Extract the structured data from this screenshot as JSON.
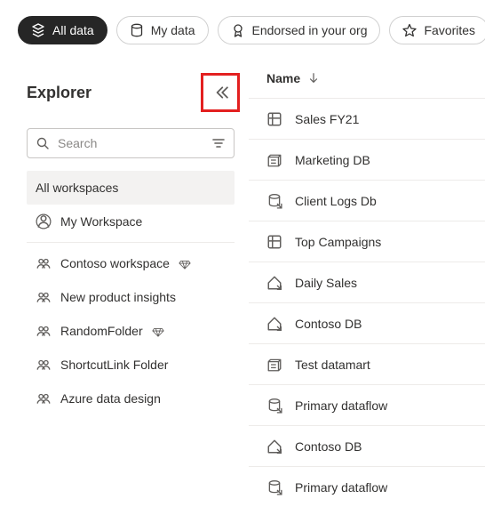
{
  "filters": {
    "all_data": "All data",
    "my_data": "My data",
    "endorsed": "Endorsed in your org",
    "favorites": "Favorites"
  },
  "explorer": {
    "title": "Explorer",
    "search_placeholder": "Search",
    "all_workspaces": "All workspaces",
    "items": [
      {
        "label": "My Workspace",
        "icon": "person",
        "premium": false
      },
      {
        "label": "Contoso workspace",
        "icon": "group",
        "premium": true
      },
      {
        "label": "New product insights",
        "icon": "group",
        "premium": false
      },
      {
        "label": "RandomFolder",
        "icon": "group",
        "premium": true
      },
      {
        "label": "ShortcutLink Folder",
        "icon": "group",
        "premium": false
      },
      {
        "label": "Azure data design",
        "icon": "group",
        "premium": false
      }
    ]
  },
  "table": {
    "name_header": "Name",
    "rows": [
      {
        "label": "Sales FY21",
        "icon": "dataset"
      },
      {
        "label": "Marketing DB",
        "icon": "datamart"
      },
      {
        "label": "Client Logs Db",
        "icon": "dataflow"
      },
      {
        "label": "Top Campaigns",
        "icon": "dataset"
      },
      {
        "label": "Daily Sales",
        "icon": "house"
      },
      {
        "label": "Contoso DB",
        "icon": "house"
      },
      {
        "label": "Test datamart",
        "icon": "datamart"
      },
      {
        "label": "Primary dataflow",
        "icon": "dataflow"
      },
      {
        "label": "Contoso DB",
        "icon": "house"
      },
      {
        "label": "Primary dataflow",
        "icon": "dataflow"
      }
    ]
  }
}
